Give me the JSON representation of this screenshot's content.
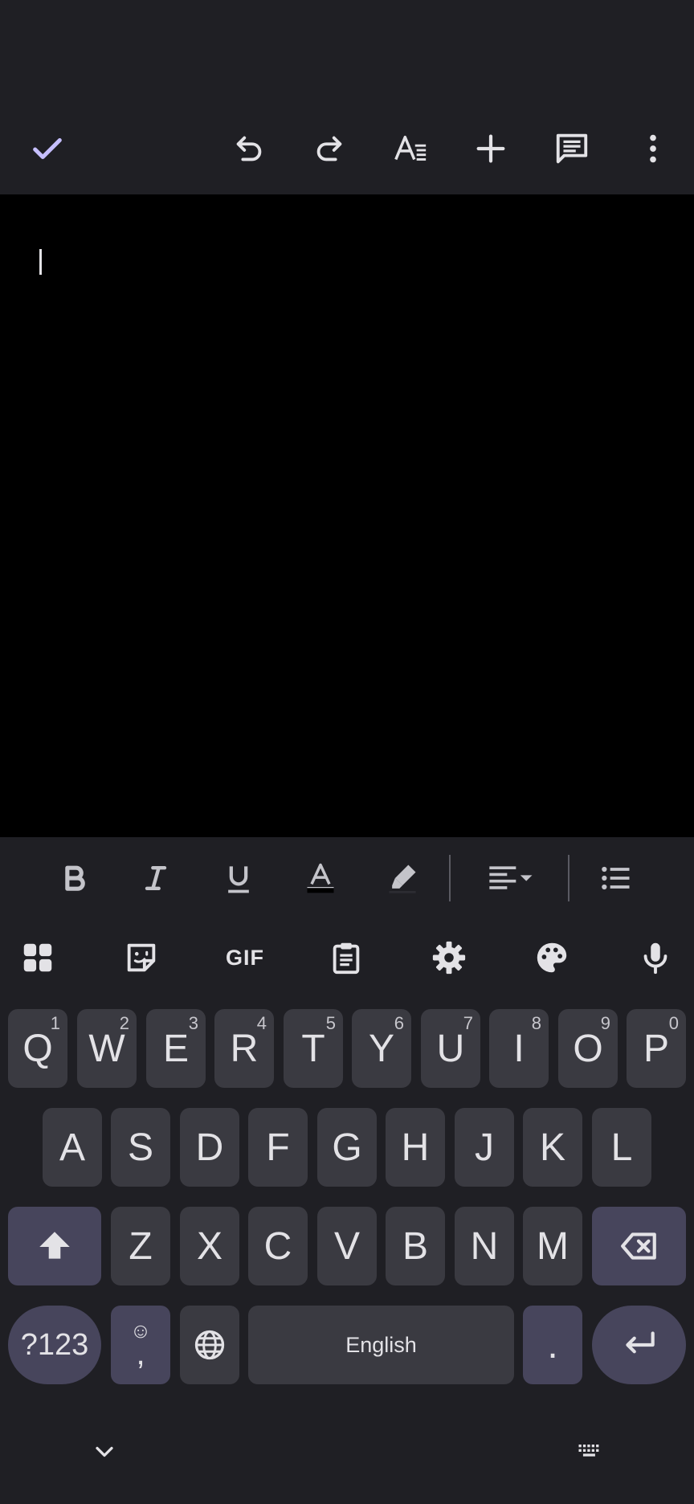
{
  "toolbar": {
    "icons": [
      "check-icon",
      "undo-icon",
      "redo-icon",
      "text-format-icon",
      "insert-plus-icon",
      "comment-icon",
      "more-vert-icon"
    ],
    "accent_color": "#c6bfff"
  },
  "editor": {
    "content": ""
  },
  "format_bar": {
    "icons": [
      "bold-icon",
      "italic-icon",
      "underline-icon",
      "text-color-icon",
      "highlight-icon",
      "align-left-dropdown-icon",
      "bulleted-list-icon"
    ]
  },
  "keyboard_strip": {
    "gif_label": "GIF",
    "icons": [
      "apps-grid-icon",
      "sticker-icon",
      "gif-icon",
      "clipboard-icon",
      "settings-icon",
      "palette-icon",
      "mic-icon"
    ]
  },
  "keyboard": {
    "row1": [
      {
        "label": "Q",
        "hint": "1"
      },
      {
        "label": "W",
        "hint": "2"
      },
      {
        "label": "E",
        "hint": "3"
      },
      {
        "label": "R",
        "hint": "4"
      },
      {
        "label": "T",
        "hint": "5"
      },
      {
        "label": "Y",
        "hint": "6"
      },
      {
        "label": "U",
        "hint": "7"
      },
      {
        "label": "I",
        "hint": "8"
      },
      {
        "label": "O",
        "hint": "9"
      },
      {
        "label": "P",
        "hint": "0"
      }
    ],
    "row2": [
      "A",
      "S",
      "D",
      "F",
      "G",
      "H",
      "J",
      "K",
      "L"
    ],
    "row3": [
      "Z",
      "X",
      "C",
      "V",
      "B",
      "N",
      "M"
    ],
    "symbols_label": "?123",
    "emoji_glyph": "☺",
    "comma_label": ",",
    "space_label": "English",
    "period_label": ".",
    "key_bg": "#3a3a41",
    "accent_key_bg": "#47455c"
  },
  "nav": {
    "icons": [
      "chevron-down-icon",
      "keyboard-icon"
    ]
  }
}
